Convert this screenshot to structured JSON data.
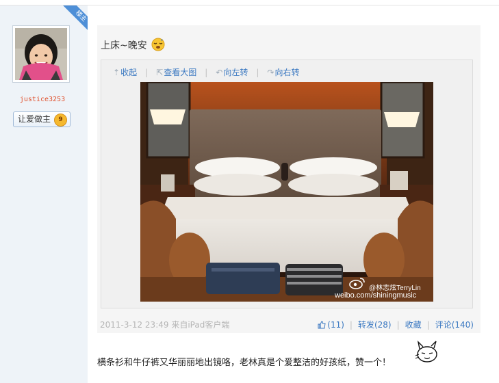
{
  "author": {
    "ribbon_label": "楼主",
    "username": "justice3253",
    "medal_label": "让爱做主",
    "medal_level": "9"
  },
  "post": {
    "text": "上床~晚安",
    "emoji_icon": "sleepy-face-icon",
    "media_toolbar": [
      {
        "icon": "collapse-icon",
        "glyph": "⇡",
        "label": "收起"
      },
      {
        "icon": "view-large-icon",
        "glyph": "⇱",
        "label": "查看大图"
      },
      {
        "icon": "rotate-left-icon",
        "glyph": "↶",
        "label": "向左转"
      },
      {
        "icon": "rotate-right-icon",
        "glyph": "↷",
        "label": "向右转"
      }
    ],
    "watermark": {
      "handle": "@林志炫TerryLin",
      "url": "weibo.com/shiningmusic"
    },
    "source": "2011-3-12 23:49 来自iPad客户端",
    "actions": {
      "like": "(11)",
      "repost": "转发(28)",
      "favorite": "收藏",
      "comment": "评论(140)"
    }
  },
  "comment": {
    "text": "横条衫和牛仔裤又华丽丽地出镜咯，老林真是个爱整洁的好孩纸，赞一个！"
  },
  "colors": {
    "link": "#3a78c1",
    "username": "#e0502c",
    "ribbon": "#4e8fd7",
    "sidebar_bg": "#eef3f8"
  }
}
